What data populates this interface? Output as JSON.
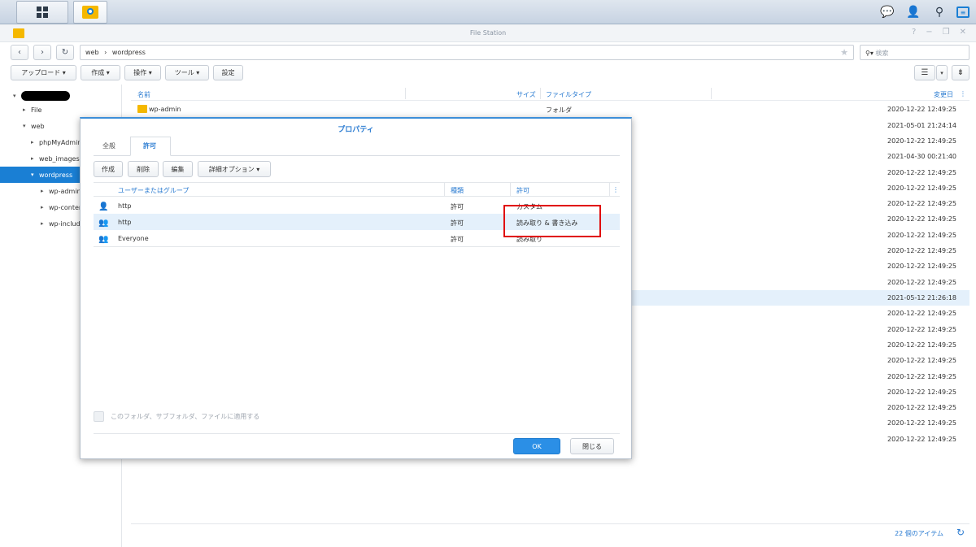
{
  "window": {
    "title": "File Station"
  },
  "taskbar": {
    "icons": [
      "apps-grid-icon",
      "file-station-icon",
      "chat-icon",
      "user-icon",
      "search-icon",
      "widgets-icon"
    ]
  },
  "nav": {
    "path": [
      "web",
      "wordpress"
    ],
    "search_placeholder": "検索"
  },
  "toolbar": {
    "upload": "アップロード",
    "create": "作成",
    "action": "操作",
    "tools": "ツール",
    "settings": "設定"
  },
  "tree": {
    "items": [
      {
        "label": "File"
      },
      {
        "label": "web"
      },
      {
        "label": "phpMyAdmin"
      },
      {
        "label": "web_images"
      },
      {
        "label": "wordpress"
      },
      {
        "label": "wp-admin"
      },
      {
        "label": "wp-content"
      },
      {
        "label": "wp-includes"
      }
    ]
  },
  "filelist": {
    "columns": {
      "name": "名前",
      "size": "サイズ",
      "type": "ファイルタイプ",
      "modified": "変更日"
    },
    "first_row": {
      "name": "wp-admin",
      "type": "フォルダ"
    },
    "dates": [
      "2020-12-22 12:49:25",
      "2021-05-01 21:24:14",
      "2020-12-22 12:49:25",
      "2021-04-30 00:21:40",
      "2020-12-22 12:49:25",
      "2020-12-22 12:49:25",
      "2020-12-22 12:49:25",
      "2020-12-22 12:49:25",
      "2020-12-22 12:49:25",
      "2020-12-22 12:49:25",
      "2020-12-22 12:49:25",
      "2020-12-22 12:49:25",
      "2021-05-12 21:26:18",
      "2020-12-22 12:49:25",
      "2020-12-22 12:49:25",
      "2020-12-22 12:49:25",
      "2020-12-22 12:49:25",
      "2020-12-22 12:49:25",
      "2020-12-22 12:49:25",
      "2020-12-22 12:49:25",
      "2020-12-22 12:49:25",
      "2020-12-22 12:49:25"
    ],
    "item_count": "22 個のアイテム"
  },
  "dialog": {
    "title": "プロパティ",
    "tabs": {
      "general": "全般",
      "permission": "許可"
    },
    "buttons": {
      "create": "作成",
      "delete": "削除",
      "edit": "編集",
      "advanced": "詳細オプション"
    },
    "columns": {
      "user": "ユーザーまたはグループ",
      "kind": "種類",
      "permission": "許可"
    },
    "rows": [
      {
        "name": "http",
        "kind": "許可",
        "permission": "カスタム"
      },
      {
        "name": "http",
        "kind": "許可",
        "permission": "読み取り & 書き込み"
      },
      {
        "name": "Everyone",
        "kind": "許可",
        "permission": "読み取り"
      }
    ],
    "apply_label": "このフォルダ、サブフォルダ、ファイルに適用する",
    "ok": "OK",
    "close": "閉じる"
  },
  "colors": {
    "accent": "#2a7bd1",
    "selection": "#1a7fd4",
    "highlight": "#e4f0fb",
    "annotation": "#e00000",
    "folder": "#f5b800"
  }
}
